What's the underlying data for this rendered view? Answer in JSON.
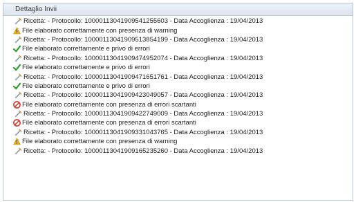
{
  "panel": {
    "title": "Dettaglio Invii"
  },
  "rows": [
    {
      "kind": "ricetta",
      "icon": "ricetta-icon",
      "text": "Ricetta: - Protocollo: 10000113041909541255603 - Data Accoglienza : 19/04/2013"
    },
    {
      "kind": "warning",
      "icon": "warning-icon",
      "text": "File elaborato correttamente con presenza di warning"
    },
    {
      "kind": "ricetta",
      "icon": "ricetta-icon",
      "text": "Ricetta: - Protocollo: 10000113041909513854199 - Data Accoglienza : 19/04/2013"
    },
    {
      "kind": "ok",
      "icon": "checkmark-icon",
      "text": "File elaborato correttamente e privo di errori"
    },
    {
      "kind": "ricetta",
      "icon": "ricetta-icon",
      "text": "Ricetta: - Protocollo: 10000113041909474952074 - Data Accoglienza : 19/04/2013"
    },
    {
      "kind": "ok",
      "icon": "checkmark-icon",
      "text": "File elaborato correttamente e privo di errori"
    },
    {
      "kind": "ricetta",
      "icon": "ricetta-icon",
      "text": "Ricetta: - Protocollo: 10000113041909471651761 - Data Accoglienza : 19/04/2013"
    },
    {
      "kind": "ok",
      "icon": "checkmark-icon",
      "text": "File elaborato correttamente e privo di errori"
    },
    {
      "kind": "ricetta",
      "icon": "ricetta-icon",
      "text": "Ricetta: - Protocollo: 10000113041909423049057 - Data Accoglienza : 19/04/2013"
    },
    {
      "kind": "error",
      "icon": "error-icon",
      "text": "File elaborato correttamente con presenza di errori scartanti"
    },
    {
      "kind": "ricetta",
      "icon": "ricetta-icon",
      "text": "Ricetta: - Protocollo: 10000113041909422749009 - Data Accoglienza : 19/04/2013"
    },
    {
      "kind": "error",
      "icon": "error-icon",
      "text": "File elaborato correttamente con presenza di errori scartanti"
    },
    {
      "kind": "ricetta",
      "icon": "ricetta-icon",
      "text": "Ricetta: - Protocollo: 10000113041909331043765 - Data Accoglienza : 19/04/2013"
    },
    {
      "kind": "warning",
      "icon": "warning-icon",
      "text": "File elaborato correttamente con presenza di warning"
    },
    {
      "kind": "ricetta",
      "icon": "ricetta-icon",
      "text": "Ricetta: - Protocollo: 10000113041909165235260 - Data Accoglienza : 19/04/2013"
    }
  ],
  "colors": {
    "header_bg": "#dde4ee",
    "ok_green": "#2e9e2e",
    "warning_yellow": "#f2b705",
    "error_red": "#d63a2f"
  }
}
